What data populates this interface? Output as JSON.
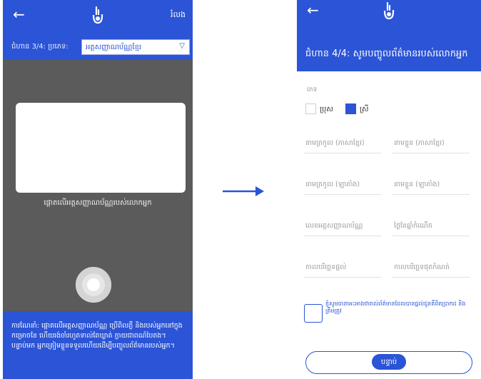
{
  "left_screen": {
    "header": {
      "back_icon": "arrow-left-icon",
      "logo_icon": "hand-tap-icon",
      "skip_label": "រំលង"
    },
    "step": {
      "label": "ជំហាន 3/4: ប្រភេទ:",
      "selected_document": "អត្តសញ្ញាណប័ណ្ណខ្មែរ",
      "dropdown_icon": "triangle-down-icon"
    },
    "camera": {
      "hint": "ផ្តោតលើអត្តសញ្ញាណប័ណ្ណរបស់លោកអ្នក",
      "shutter_icon": "camera-shutter-icon"
    },
    "note": "ការណែនាំ: ផ្តោតលើអត្តសញ្ញាណប័ណ្ណ ប្រើពិលភ្លឺ និងរបស់អ្នកនៅក្នុងកម្រោចខែ ហើយរង់ចាំរហូតទាល់តែឃ្លាត់ ក្លាយជាពណ៌បៃតង។ បន្ទាប់មក អ្នកត្រៀមខ្លួនទទួលហើយដើម្បីបញ្ចូលព័ត៌មានរបស់អ្នក។"
  },
  "flow_arrow_icon": "arrow-right-icon",
  "right_screen": {
    "header": {
      "back_icon": "arrow-left-icon",
      "logo_icon": "hand-tap-icon",
      "title": "ជំហាន 4/4: សូមបញ្ចូលព័ត៌មានរបស់លោកអ្នក"
    },
    "gender": {
      "label": "ភេទ",
      "options": [
        {
          "label": "ប្រុស",
          "checked": false
        },
        {
          "label": "ស្រី",
          "checked": true
        }
      ]
    },
    "fields": [
      {
        "placeholder": "នាមត្រកូល (ភាសាខ្មែរ)"
      },
      {
        "placeholder": "នាមខ្លួន (ភាសាខ្មែរ)"
      },
      {
        "placeholder": "នាមត្រកូល (ឡាតាំង)"
      },
      {
        "placeholder": "នាមខ្លួន (ឡាតាំង)"
      },
      {
        "placeholder": "លេខអត្តសញ្ញាណប័ណ្ណ"
      },
      {
        "placeholder": "ថ្ងៃខែឆ្នាំកំណើត"
      },
      {
        "placeholder": "កាលបរិច្ឆេទផ្តល់"
      },
      {
        "placeholder": "កាលបរិច្ឆេទផុតកំណត់"
      }
    ],
    "agreement": "ខ្ញុំសូមធានាអះអាងថារាល់ព័ត៌មានដែលបានផ្តល់ជូនគឺពិតប្រាកដ និងត្រឹមត្រូវ",
    "next_label": "បន្ទាប់"
  },
  "colors": {
    "primary": "#2b54d6",
    "camera_bg": "#5b5b5b"
  }
}
